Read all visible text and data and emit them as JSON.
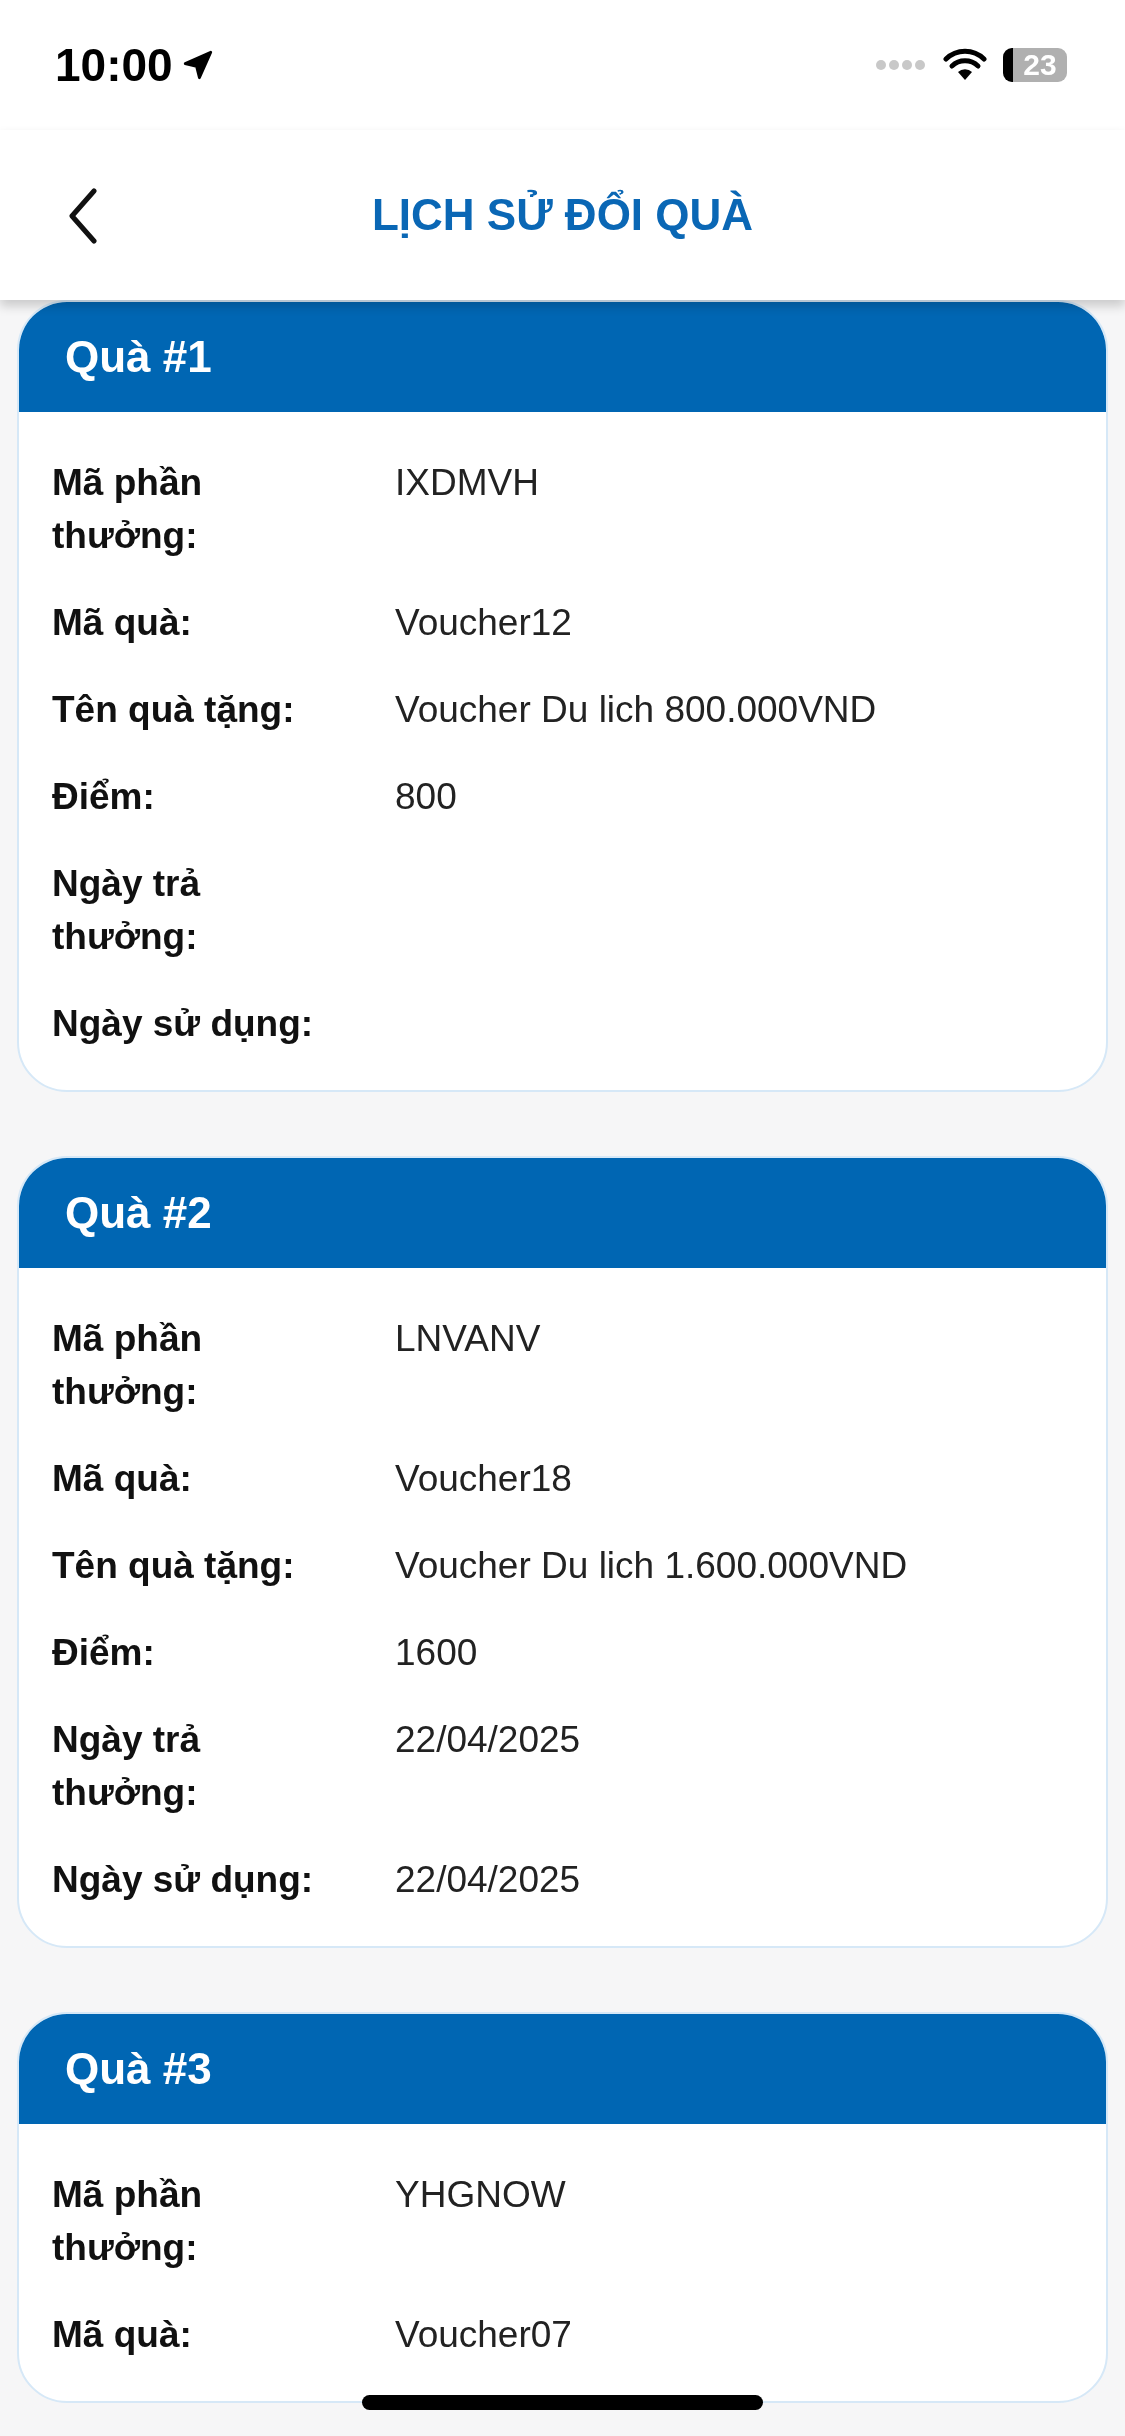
{
  "status_bar": {
    "time": "10:00",
    "battery": "23"
  },
  "header": {
    "title": "LỊCH SỬ ĐỔI QUÀ"
  },
  "gifts": [
    {
      "title": "Quà #1",
      "fields": [
        {
          "label": "Mã phần thưởng:",
          "value": "IXDMVH"
        },
        {
          "label": "Mã quà:",
          "value": "Voucher12"
        },
        {
          "label": "Tên quà tặng:",
          "value": "Voucher Du lich 800.000VND"
        },
        {
          "label": "Điểm:",
          "value": "800"
        },
        {
          "label": "Ngày trả thưởng:"
        },
        {
          "label": "Ngày sử dụng:"
        }
      ]
    },
    {
      "title": "Quà #2",
      "fields": [
        {
          "label": "Mã phần thưởng:",
          "value": "LNVANV"
        },
        {
          "label": "Mã quà:",
          "value": "Voucher18"
        },
        {
          "label": "Tên quà tặng:",
          "value": "Voucher Du lich 1.600.000VND"
        },
        {
          "label": "Điểm:",
          "value": "1600"
        },
        {
          "label": "Ngày trả thưởng:",
          "value": "22/04/2025"
        },
        {
          "label": "Ngày sử dụng:",
          "value": "22/04/2025"
        }
      ]
    },
    {
      "title": "Quà #3",
      "fields": [
        {
          "label": "Mã phần thưởng:",
          "value": "YHGNOW"
        },
        {
          "label": "Mã quà:",
          "value": "Voucher07"
        }
      ]
    }
  ]
}
